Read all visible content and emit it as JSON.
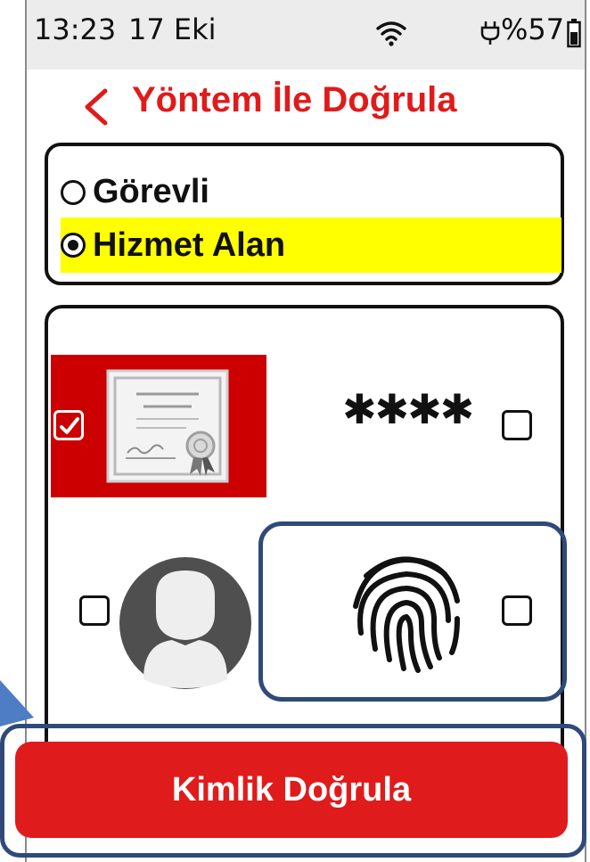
{
  "status_bar": {
    "time": "13:23",
    "date": "17 Eki",
    "battery": "%57",
    "icons": [
      "wifi-icon",
      "plug-icon",
      "battery-icon"
    ]
  },
  "header": {
    "title": "Yöntem İle Doğrula",
    "back_icon": "chevron-left-icon"
  },
  "roles": {
    "items": [
      {
        "label": "Görevli",
        "selected": false
      },
      {
        "label": "Hizmet Alan",
        "selected": true
      }
    ]
  },
  "methods": {
    "pin_mask": "✱✱✱✱",
    "items": [
      {
        "name": "certificate",
        "checked": true
      },
      {
        "name": "pin",
        "checked": false
      },
      {
        "name": "face",
        "checked": false
      },
      {
        "name": "fingerprint",
        "checked": false
      }
    ]
  },
  "action": {
    "label": "Kimlik Doğrula"
  },
  "colors": {
    "accent": "#e01b1b",
    "highlight": "#ffff00",
    "frame": "#2f4a7a",
    "cert_bg": "#cc0000"
  }
}
